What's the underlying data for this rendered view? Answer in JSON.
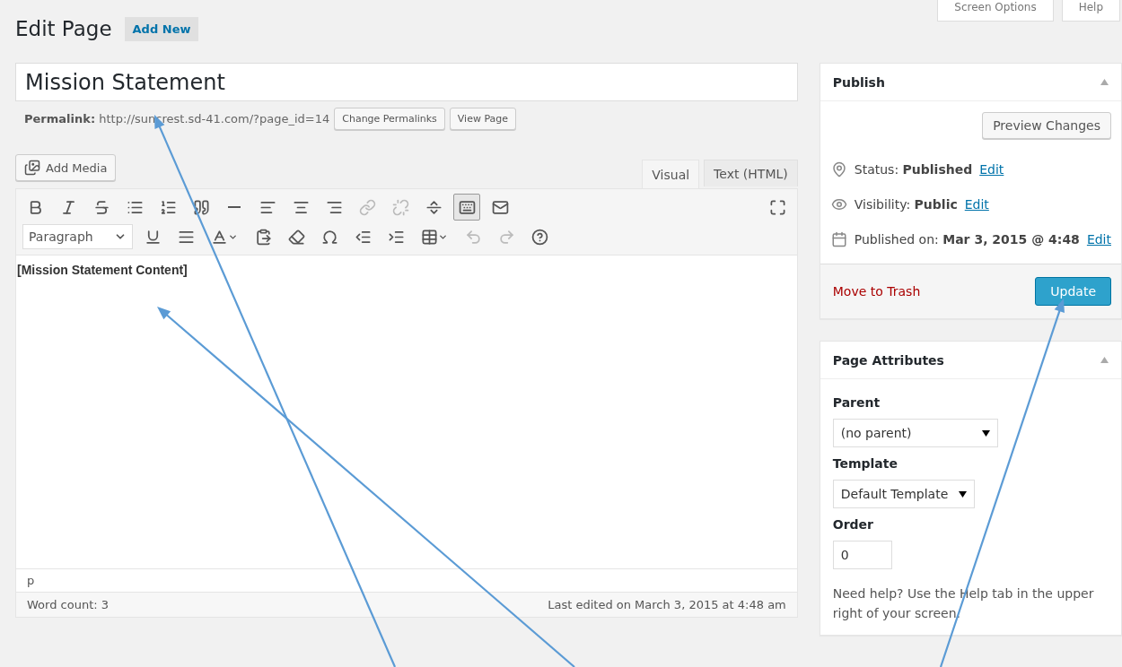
{
  "header": {
    "title": "Edit Page",
    "add_new": "Add New"
  },
  "top_tabs": [
    {
      "label": "Screen Options"
    },
    {
      "label": "Help"
    }
  ],
  "title_field": {
    "value": "Mission Statement"
  },
  "permalink": {
    "label": "Permalink:",
    "url": "http://suncrest.sd-41.com/?page_id=14",
    "buttons": [
      "Change Permalinks",
      "View Page"
    ]
  },
  "add_media": "Add Media",
  "editor_tabs": [
    {
      "label": "Visual",
      "selected": true
    },
    {
      "label": "Text (HTML)",
      "selected": false
    }
  ],
  "toolbar_rows": [
    [
      {
        "kind": "bold",
        "disabled": false,
        "pressed": false
      },
      {
        "kind": "italic",
        "disabled": false,
        "pressed": false
      },
      {
        "kind": "strike",
        "disabled": false,
        "pressed": false
      },
      {
        "kind": "bullets",
        "disabled": false,
        "pressed": false
      },
      {
        "kind": "numbers",
        "disabled": false,
        "pressed": false
      },
      {
        "kind": "quote",
        "disabled": false,
        "pressed": false
      },
      {
        "kind": "rule",
        "disabled": false,
        "pressed": false
      },
      {
        "kind": "align-left",
        "disabled": false,
        "pressed": false
      },
      {
        "kind": "align-center",
        "disabled": false,
        "pressed": false
      },
      {
        "kind": "align-right",
        "disabled": false,
        "pressed": false
      },
      {
        "kind": "link",
        "disabled": true,
        "pressed": false
      },
      {
        "kind": "unlink",
        "disabled": true,
        "pressed": false
      },
      {
        "kind": "more",
        "disabled": false,
        "pressed": false
      },
      {
        "kind": "kitchen-sink",
        "disabled": false,
        "pressed": true
      },
      {
        "kind": "mail",
        "disabled": false,
        "pressed": false
      },
      {
        "kind": "fullscreen",
        "disabled": false,
        "pressed": false
      }
    ],
    [
      {
        "kind": "format-select",
        "label": "Paragraph"
      },
      {
        "kind": "underline",
        "disabled": false,
        "pressed": false
      },
      {
        "kind": "justify",
        "disabled": false,
        "pressed": false
      },
      {
        "kind": "text-color",
        "disabled": false,
        "pressed": false
      },
      {
        "kind": "paste-text",
        "disabled": false,
        "pressed": false
      },
      {
        "kind": "eraser",
        "disabled": false,
        "pressed": false
      },
      {
        "kind": "omega",
        "disabled": false,
        "pressed": false
      },
      {
        "kind": "outdent",
        "disabled": false,
        "pressed": false
      },
      {
        "kind": "indent",
        "disabled": false,
        "pressed": false
      },
      {
        "kind": "table",
        "disabled": false,
        "pressed": false
      },
      {
        "kind": "undo",
        "disabled": true,
        "pressed": false
      },
      {
        "kind": "redo",
        "disabled": true,
        "pressed": false
      },
      {
        "kind": "help",
        "disabled": false,
        "pressed": false
      }
    ]
  ],
  "content": "[Mission Statement Content]",
  "path": "p",
  "word_count": "Word count: 3",
  "last_edited": "Last edited on March 3, 2015 at 4:48 am",
  "publish": {
    "title": "Publish",
    "preview": "Preview Changes",
    "rows": [
      {
        "kind": "status",
        "label": "Status:",
        "value": "Published",
        "link": "Edit"
      },
      {
        "kind": "visibility",
        "label": "Visibility:",
        "value": "Public",
        "link": "Edit"
      },
      {
        "kind": "date",
        "label": "Published on:",
        "value": "Mar 3, 2015 @ 4:48",
        "link": "Edit"
      }
    ],
    "trash": "Move to Trash",
    "update": "Update"
  },
  "page_attributes": {
    "title": "Page Attributes",
    "fields": [
      {
        "kind": "select",
        "label": "Parent",
        "value": "(no parent)"
      },
      {
        "kind": "select",
        "label": "Template",
        "value": "Default Template"
      },
      {
        "kind": "input",
        "label": "Order",
        "value": "0"
      }
    ],
    "help": "Need help? Use the Help tab in the upper right of your screen."
  }
}
